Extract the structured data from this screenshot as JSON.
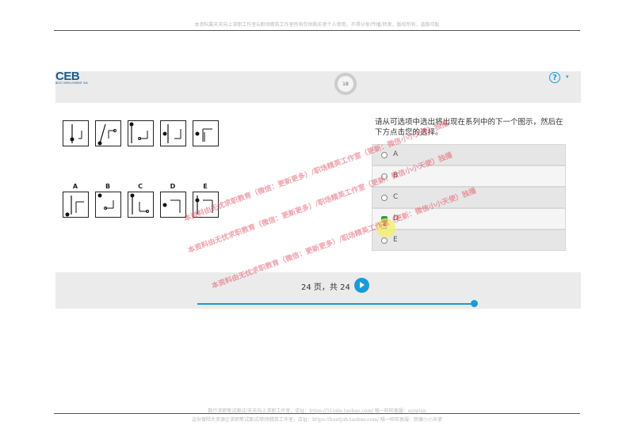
{
  "doc": {
    "header": "本资料属天天向上求职工作室&职场精英工作室所有仅供购买者个人使用，不得分享/传播/转卖，版权所有，盗版可耻",
    "footer_line1": "数行求职笔试面试/天天向上求职工作室，店址：https://51jobs.taobao.com/ 唯一旺旺客服：gsiwjsn",
    "footer_line2": "這份保险大资源企求职笔试面试/职场精英工作室，店址：https://huntjob.taobao.com/ 唯一旺旺客服：胖魔小小天使"
  },
  "app": {
    "logo": "CEB",
    "logo_sub": "BEST EMPLOYMENT INC",
    "timer": "18",
    "help_icon": "?",
    "help_caret": "▾"
  },
  "question": {
    "prompt": "请从可选项中选出将出现在系列中的下一个图示，然后在下方点击您的选择。",
    "answer_letters": [
      "A",
      "B",
      "C",
      "D",
      "E"
    ],
    "options": [
      {
        "label": "A",
        "selected": false
      },
      {
        "label": "B",
        "selected": false
      },
      {
        "label": "C",
        "selected": false
      },
      {
        "label": "D",
        "selected": true
      },
      {
        "label": "E",
        "selected": false
      }
    ]
  },
  "footer": {
    "page_text": "24 页，共 24",
    "progress_percent": 100
  },
  "watermarks": [
    "本资料由无忧求职教育（微信：更新更多）/职场精英工作室（更新：微信小小天使）独播",
    "本资料由无忧求职教育（微信：更新更多）/职场精英工作室（更新：微信小小天使）独播",
    "本资料由无忧求职教育（微信：更新更多）/职场精英工作室（更新：微信小小天使）独播"
  ],
  "colors": {
    "accent": "#1a9bd7",
    "selected": "#2e9e3e",
    "logo": "#1f5a8c"
  }
}
